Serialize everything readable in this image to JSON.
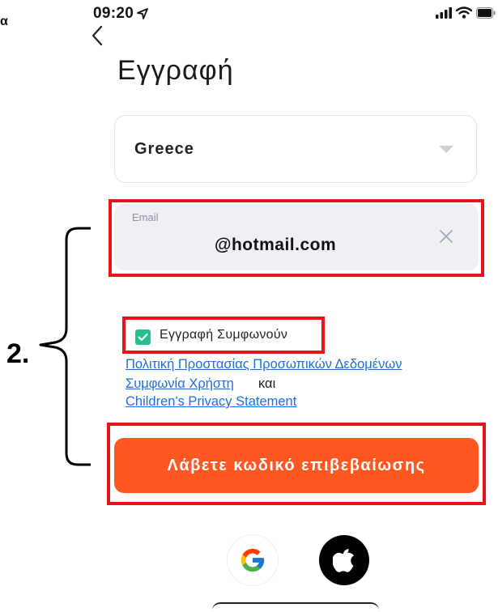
{
  "annotation": {
    "stray_char": "α",
    "step_label": "2."
  },
  "status_bar": {
    "time": "09:20",
    "icons": [
      "location-arrow-icon",
      "signal-icon",
      "wifi-icon",
      "battery-icon"
    ]
  },
  "header": {
    "back_icon": "chevron-left-icon",
    "title": "Εγγραφή"
  },
  "form": {
    "country": {
      "value": "Greece",
      "icon": "dropdown-triangle-icon"
    },
    "email": {
      "label": "Email",
      "value": "@hotmail.com",
      "clear_icon": "close-icon"
    },
    "agreement": {
      "checked": true,
      "label": "Εγγραφή Συμφωνούν",
      "privacy_policy_link": "Πολιτική Προστασίας Προσωπικών Δεδομένων",
      "user_agreement_link": "Συμφωνία Χρήστη",
      "conjunction": "και",
      "children_privacy_link": "Children's Privacy Statement"
    },
    "submit_label": "Λάβετε κωδικό επιβεβαίωσης"
  },
  "social_login": {
    "google_icon": "google-icon",
    "apple_icon": "apple-icon"
  },
  "colors": {
    "accent": "#ff5722",
    "checkbox": "#22c28a",
    "link": "#1e6fd9",
    "highlight": "#e8131b",
    "input_bg": "#eef0f5"
  }
}
